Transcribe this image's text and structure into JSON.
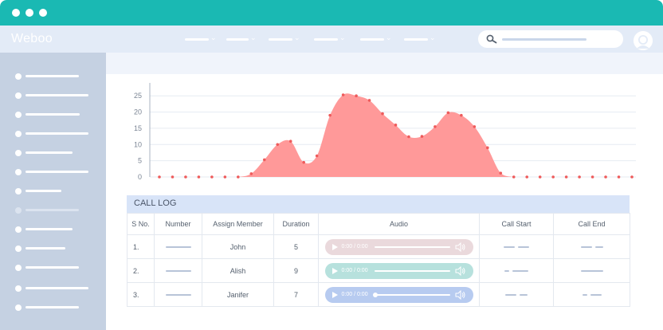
{
  "app": {
    "brand": "Weboo"
  },
  "colors": {
    "titlebar": "#1ab9b3",
    "navbar": "#e3ebf7",
    "sidebar": "#c5d1e2",
    "chart_fill": "#ff9999",
    "chart_point": "#ee5b5b",
    "audio_row1": "#ead9dc",
    "audio_row2": "#b7e1dd",
    "audio_row3": "#b7cbf0"
  },
  "navbar": {
    "menu_item_count": 6,
    "search_icon": "magnifier-icon",
    "avatar_icon": "user-avatar-icon"
  },
  "sidebar": {
    "item_count": 13
  },
  "chart_data": {
    "type": "area",
    "title": "",
    "xlabel": "",
    "ylabel": "",
    "ylim": [
      0,
      28
    ],
    "yticks": [
      "0",
      "5",
      "10",
      "15",
      "20",
      "25"
    ],
    "grid": true,
    "series": [
      {
        "values": [
          0,
          0,
          0,
          0,
          0,
          0,
          0,
          1,
          5.3,
          10,
          11,
          4.5,
          6.5,
          19,
          25.3,
          25,
          23.6,
          19.5,
          16,
          12.4,
          12.5,
          15.5,
          19.8,
          19,
          15.5,
          9,
          1.2,
          0,
          0,
          0,
          0,
          0,
          0,
          0,
          0,
          0,
          0
        ]
      }
    ]
  },
  "calllog": {
    "title": "CALL LOG",
    "headers": [
      "S No.",
      "Number",
      "Assign Member",
      "Duration",
      "Audio",
      "Call Start",
      "Call End"
    ],
    "rows": [
      {
        "sno": "1.",
        "member": "John",
        "duration": "5",
        "audio_time": "0:00 / 0:00"
      },
      {
        "sno": "2.",
        "member": "Alish",
        "duration": "9",
        "audio_time": "0:00 / 0:00"
      },
      {
        "sno": "3.",
        "member": "Janifer",
        "duration": "7",
        "audio_time": "0:00 / 0:00"
      }
    ]
  }
}
